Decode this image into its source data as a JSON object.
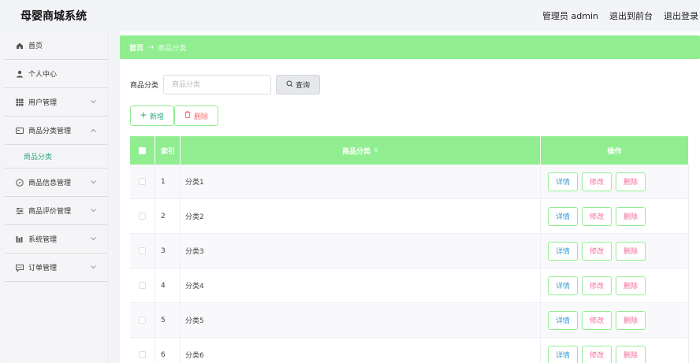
{
  "app": {
    "title": "母婴商城系统"
  },
  "header": {
    "user_label": "管理员 admin",
    "to_front": "退出到前台",
    "logout": "退出登录"
  },
  "sidebar": {
    "items": [
      {
        "label": "首页",
        "icon": "home-icon"
      },
      {
        "label": "个人中心",
        "icon": "user-icon"
      },
      {
        "label": "用户管理",
        "icon": "grid-icon"
      },
      {
        "label": "商品分类管理",
        "icon": "card-icon",
        "expanded": true,
        "children": [
          {
            "label": "商品分类"
          }
        ]
      },
      {
        "label": "商品信息管理",
        "icon": "compass-icon"
      },
      {
        "label": "商品评价管理",
        "icon": "sliders-icon"
      },
      {
        "label": "系统管理",
        "icon": "bars-icon"
      },
      {
        "label": "订单管理",
        "icon": "chat-icon"
      }
    ]
  },
  "breadcrumb": {
    "home": "首页",
    "arrow": "→",
    "current": "商品分类"
  },
  "search": {
    "label": "商品分类",
    "placeholder": "商品分类",
    "value": "",
    "button": "查询"
  },
  "actions": {
    "add": "新增",
    "delete": "删除"
  },
  "table": {
    "columns": {
      "index": "索引",
      "name": "商品分类",
      "ops": "操作"
    },
    "ops": {
      "detail": "详情",
      "edit": "修改",
      "delete": "删除"
    },
    "rows": [
      {
        "index": "1",
        "name": "分类1"
      },
      {
        "index": "2",
        "name": "分类2"
      },
      {
        "index": "3",
        "name": "分类3"
      },
      {
        "index": "4",
        "name": "分类4"
      },
      {
        "index": "5",
        "name": "分类5"
      },
      {
        "index": "6",
        "name": "分类6"
      }
    ]
  },
  "colors": {
    "accent": "#90ee90",
    "active_menu": "#2fa87f",
    "danger": "#f56c6c",
    "info": "#3a9ad9"
  }
}
